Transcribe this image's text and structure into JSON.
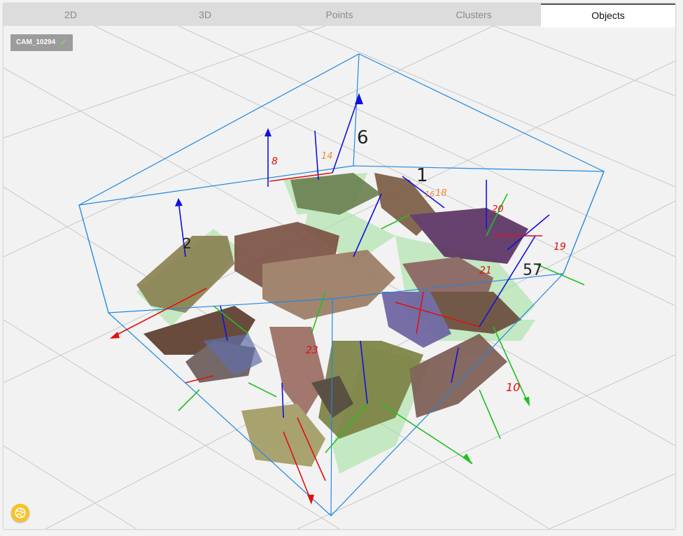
{
  "tabs": [
    {
      "label": "2D"
    },
    {
      "label": "3D"
    },
    {
      "label": "Points"
    },
    {
      "label": "Clusters"
    },
    {
      "label": "Objects"
    }
  ],
  "active_tab": "Objects",
  "camera": {
    "name": "CAM_10294",
    "status_icon": "check-icon"
  },
  "capture_button": {
    "icon": "camera-aperture-icon"
  },
  "object_labels": [
    {
      "text": "6",
      "color": "#222222"
    },
    {
      "text": "1",
      "color": "#222222"
    },
    {
      "text": "8",
      "color": "#e01010"
    },
    {
      "text": "14",
      "color": "#f08a30"
    },
    {
      "text": "18",
      "color": "#f08a30"
    },
    {
      "text": "16",
      "color": "#f08a30"
    },
    {
      "text": "20",
      "color": "#e01010"
    },
    {
      "text": "19",
      "color": "#e01010"
    },
    {
      "text": "21",
      "color": "#e01010"
    },
    {
      "text": "2",
      "color": "#222222"
    },
    {
      "text": "23",
      "color": "#e01010"
    },
    {
      "text": "10",
      "color": "#e01010"
    },
    {
      "text": "57",
      "color": "#222222"
    }
  ],
  "colors": {
    "bbox": "#1e88e5",
    "axis_x": "#e01010",
    "axis_y": "#20c020",
    "axis_z": "#1010e0",
    "grid": "#c8c8c8",
    "accent": "#f7c325"
  }
}
